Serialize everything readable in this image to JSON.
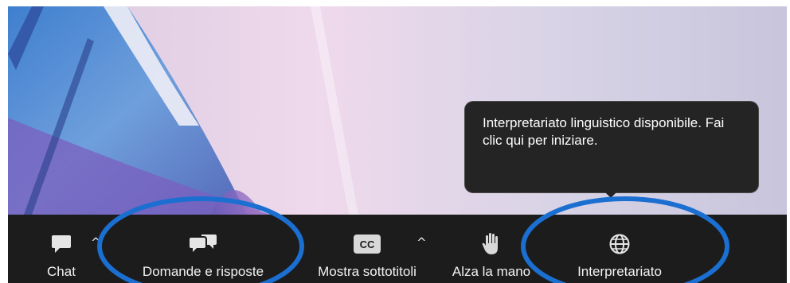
{
  "toolbar": {
    "chat": {
      "label": "Chat",
      "icon": "chat-bubble-icon"
    },
    "qa": {
      "label": "Domande e risposte",
      "icon": "qa-bubbles-icon"
    },
    "captions": {
      "label": "Mostra sottotitoli",
      "icon": "closed-captions-icon",
      "icon_text": "CC"
    },
    "raise_hand": {
      "label": "Alza la mano",
      "icon": "raise-hand-icon"
    },
    "interpretation": {
      "label": "Interpretariato",
      "icon": "globe-icon"
    },
    "caret": "^"
  },
  "tooltip": {
    "text": "Interpretariato linguistico disponibile. Fai clic qui per iniziare."
  },
  "colors": {
    "toolbar_bg": "#1c1c1c",
    "tooltip_bg": "#242424",
    "annotation_circle": "#1a6fd1"
  }
}
